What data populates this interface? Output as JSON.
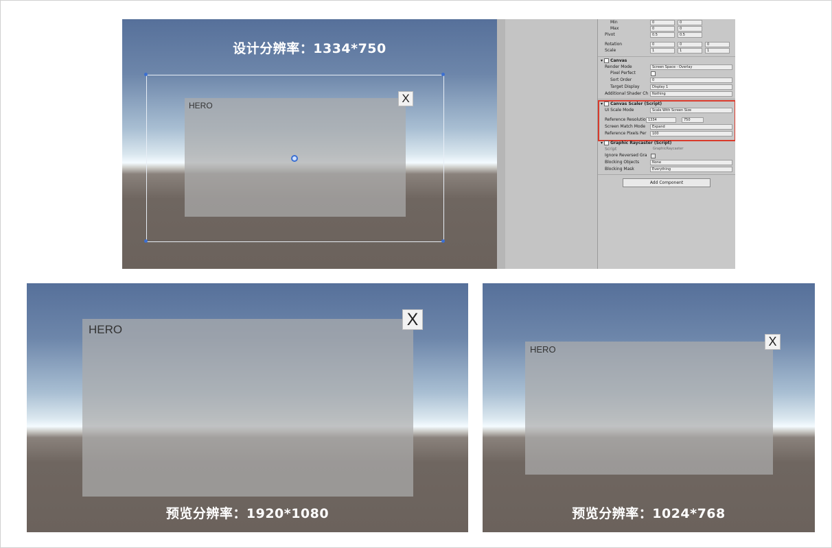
{
  "top": {
    "caption": "设计分辨率：1334*750",
    "hero_label": "HERO",
    "close_label": "X"
  },
  "inspector": {
    "rect_rows": [
      {
        "label": "Min",
        "x": "0",
        "y": "0"
      },
      {
        "label": "Max",
        "x": "0",
        "y": "0"
      },
      {
        "label": "Pivot",
        "x": "0.5",
        "y": "0.5"
      },
      {
        "label": "Rotation",
        "x": "0",
        "y": "0",
        "z": "0"
      },
      {
        "label": "Scale",
        "x": "1",
        "y": "1",
        "z": "1"
      }
    ],
    "canvas": {
      "title": "Canvas",
      "render_mode_label": "Render Mode",
      "render_mode_value": "Screen Space - Overlay",
      "pixel_perfect_label": "Pixel Perfect",
      "sort_order_label": "Sort Order",
      "sort_order_value": "0",
      "target_display_label": "Target Display",
      "target_display_value": "Display 1",
      "shader_label": "Additional Shader Ch",
      "shader_value": "Nothing"
    },
    "scaler": {
      "title": "Canvas Scaler (Script)",
      "ui_scale_mode_label": "UI Scale Mode",
      "ui_scale_mode_value": "Scale With Screen Size",
      "ref_res_label": "Reference Resolution",
      "ref_x": "1334",
      "ref_y": "750",
      "match_mode_label": "Screen Match Mode",
      "match_mode_value": "Expand",
      "ref_ppu_label": "Reference Pixels Per",
      "ref_ppu_value": "100"
    },
    "raycaster": {
      "title": "Graphic Raycaster (Script)",
      "script_label": "Script",
      "script_value": "GraphicRaycaster",
      "ignore_label": "Ignore Reversed Gra",
      "blocking_objects_label": "Blocking Objects",
      "blocking_objects_value": "None",
      "blocking_mask_label": "Blocking Mask",
      "blocking_mask_value": "Everything"
    },
    "add_component": "Add Component"
  },
  "bottom_left": {
    "caption": "预览分辨率：1920*1080",
    "hero_label": "HERO",
    "close_label": "X"
  },
  "bottom_right": {
    "caption": "预览分辨率：1024*768",
    "hero_label": "HERO",
    "close_label": "X"
  }
}
